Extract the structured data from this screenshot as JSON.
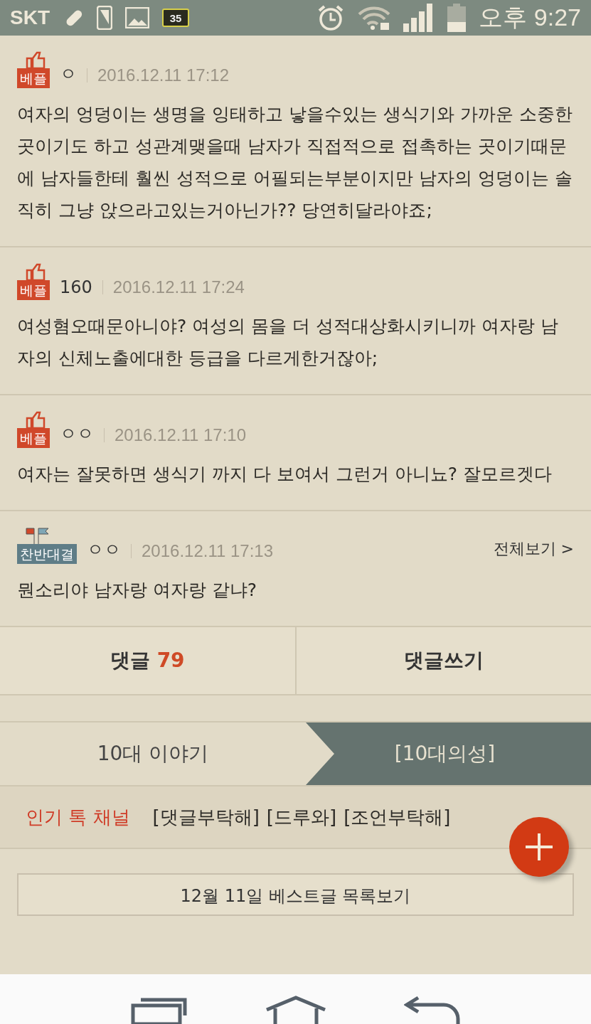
{
  "status_bar": {
    "carrier": "SKT",
    "battery": "35",
    "time": "오후 9:27"
  },
  "comments": [
    {
      "badge": {
        "kind": "best",
        "label": "베플"
      },
      "author": "ㅇ",
      "date": "2016.12.11 17:12",
      "text": "여자의 엉덩이는 생명을 잉태하고 낳을수있는 생식기와 가까운 소중한곳이기도 하고 성관계맺을때 남자가 직접적으로 접촉하는 곳이기때문에 남자들한테 훨씬 성적으로 어필되는부분이지만 남자의 엉덩이는 솔직히 그냥 앉으라고있는거아닌가?? 당연히달라야죠;"
    },
    {
      "badge": {
        "kind": "best",
        "label": "베플"
      },
      "author": "160",
      "date": "2016.12.11 17:24",
      "text": "여성혐오때문아니야? 여성의 몸을 더 성적대상화시키니까 여자랑 남자의 신체노출에대한 등급을 다르게한거잖아;"
    },
    {
      "badge": {
        "kind": "best",
        "label": "베플"
      },
      "author": "ㅇㅇ",
      "date": "2016.12.11 17:10",
      "text": "여자는 잘못하면 생식기 까지 다 보여서 그런거 아니뇨? 잘모르겟다"
    },
    {
      "badge": {
        "kind": "debate",
        "label": "찬반대결"
      },
      "author": "ㅇㅇ",
      "date": "2016.12.11 17:13",
      "view_all": "전체보기 >",
      "text": "뭔소리야 남자랑 여자랑 같냐?"
    }
  ],
  "actions": {
    "comments_label": "댓글",
    "comments_count": "79",
    "write_label": "댓글쓰기"
  },
  "tabs": [
    {
      "label": "10대 이야기",
      "selected": false
    },
    {
      "label": "[10대의성]",
      "selected": true
    }
  ],
  "popular": {
    "label": "인기 톡 채널",
    "links": [
      "[댓글부탁해]",
      "[드루와]",
      "[조언부탁해]"
    ]
  },
  "best_list_button": "12월 11일 베스트글 목록보기"
}
